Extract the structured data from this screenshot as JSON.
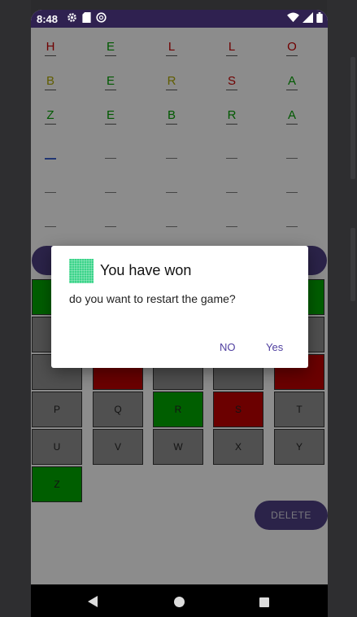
{
  "status_bar": {
    "time": "8:48",
    "left_icons": [
      "gear-icon",
      "sd-card-icon",
      "sync-icon"
    ],
    "right_icons": [
      "wifi-icon",
      "signal-icon",
      "battery-icon"
    ]
  },
  "board": {
    "rows": [
      [
        {
          "letter": "H",
          "color": "#c00000"
        },
        {
          "letter": "E",
          "color": "#009a00"
        },
        {
          "letter": "L",
          "color": "#c00000"
        },
        {
          "letter": "L",
          "color": "#c00000"
        },
        {
          "letter": "O",
          "color": "#c00000"
        }
      ],
      [
        {
          "letter": "B",
          "color": "#a5a000"
        },
        {
          "letter": "E",
          "color": "#009a00"
        },
        {
          "letter": "R",
          "color": "#a5a000"
        },
        {
          "letter": "S",
          "color": "#c00000"
        },
        {
          "letter": "A",
          "color": "#009a00"
        }
      ],
      [
        {
          "letter": "Z",
          "color": "#009a00"
        },
        {
          "letter": "E",
          "color": "#009a00"
        },
        {
          "letter": "B",
          "color": "#009a00"
        },
        {
          "letter": "R",
          "color": "#009a00"
        },
        {
          "letter": "A",
          "color": "#009a00"
        }
      ]
    ],
    "empty_rows": 3
  },
  "keyboard": {
    "rows": [
      [
        {
          "label": "",
          "state": "green"
        },
        {
          "label": "",
          "state": "hidden"
        },
        {
          "label": "",
          "state": "hidden"
        },
        {
          "label": "",
          "state": "hidden"
        },
        {
          "label": "",
          "state": "green"
        }
      ],
      [
        {
          "label": "",
          "state": "gray"
        },
        {
          "label": "",
          "state": "hidden"
        },
        {
          "label": "",
          "state": "hidden"
        },
        {
          "label": "",
          "state": "hidden"
        },
        {
          "label": "",
          "state": "gray"
        }
      ],
      [
        {
          "label": "",
          "state": "gray"
        },
        {
          "label": "",
          "state": "red"
        },
        {
          "label": "",
          "state": "gray"
        },
        {
          "label": "",
          "state": "gray"
        },
        {
          "label": "",
          "state": "red"
        }
      ],
      [
        {
          "label": "P",
          "state": "gray"
        },
        {
          "label": "Q",
          "state": "gray"
        },
        {
          "label": "R",
          "state": "green"
        },
        {
          "label": "S",
          "state": "red"
        },
        {
          "label": "T",
          "state": "gray"
        }
      ],
      [
        {
          "label": "U",
          "state": "gray"
        },
        {
          "label": "V",
          "state": "gray"
        },
        {
          "label": "W",
          "state": "gray"
        },
        {
          "label": "X",
          "state": "gray"
        },
        {
          "label": "Y",
          "state": "gray"
        }
      ],
      [
        {
          "label": "Z",
          "state": "green"
        }
      ]
    ],
    "state_colors": {
      "green": "#00a300",
      "red": "#b80000",
      "gray": "#8a8a8a"
    }
  },
  "delete_button": {
    "label": "DELETE"
  },
  "dialog": {
    "title": "You have won",
    "message": "do you want to restart the game?",
    "buttons": {
      "no": "NO",
      "yes": "Yes"
    }
  },
  "nav_bar": {
    "icons": [
      "back-icon",
      "home-icon",
      "recents-icon"
    ]
  }
}
